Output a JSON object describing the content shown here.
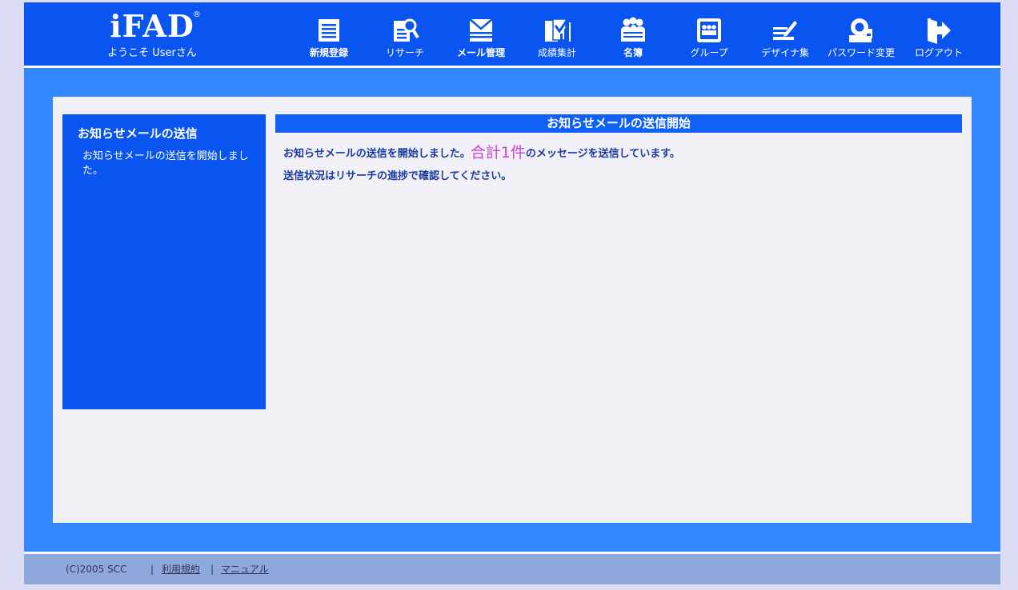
{
  "header": {
    "logo": "iFAD",
    "logo_reg": "®",
    "welcome": "ようこそ Userさん",
    "nav": [
      {
        "label": "新規登録",
        "icon": "document-icon"
      },
      {
        "label": "リサーチ",
        "icon": "search-document-icon"
      },
      {
        "label": "メール管理",
        "icon": "mail-icon"
      },
      {
        "label": "成績集計",
        "icon": "chart-document-icon"
      },
      {
        "label": "名簿",
        "icon": "people-icon"
      },
      {
        "label": "グループ",
        "icon": "group-icon"
      },
      {
        "label": "デザイナ集",
        "icon": "pen-icon"
      },
      {
        "label": "パスワード変更",
        "icon": "key-icon"
      },
      {
        "label": "ログアウト",
        "icon": "logout-icon"
      }
    ]
  },
  "sidebar": {
    "title": "お知らせメールの送信",
    "description": "お知らせメールの送信を開始しました。"
  },
  "main": {
    "heading": "お知らせメールの送信開始",
    "message1_prefix": "お知らせメールの送信を開始しました。",
    "message1_highlight": "合計1件",
    "message1_suffix": "のメッセージを送信しています。",
    "message2": "送信状況はリサーチの進捗で確認してください。"
  },
  "footer": {
    "copyright": "(C)2005 SCC",
    "separator": "|",
    "terms": "利用規約",
    "manual": "マニュアル"
  },
  "colors": {
    "header": "#0a55f0",
    "stage": "#3388ff",
    "panel": "#f0f0f6",
    "highlight": "#cc44cc",
    "footer": "#8fa8dc"
  }
}
